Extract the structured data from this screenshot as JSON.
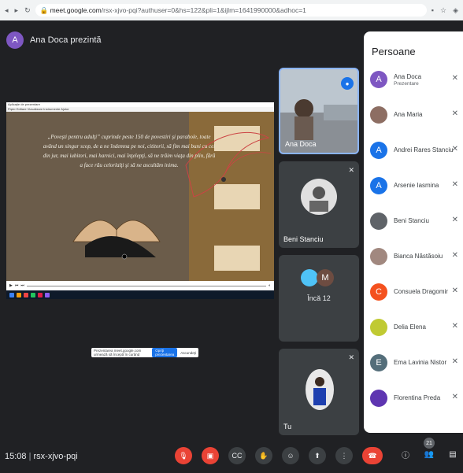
{
  "browser": {
    "url_host": "meet.google.com",
    "url_rest": "/rsx-xjvo-pqi?authuser=0&hs=122&pli=1&ijlm=1641990000&adhoc=1",
    "icons": [
      "back-icon",
      "forward-icon",
      "reload-icon",
      "lock-icon"
    ]
  },
  "presenter": {
    "initial": "A",
    "text": "Ana Doca prezintă",
    "avatar_color": "#7e57c2"
  },
  "presentation": {
    "quote": "„Poveşti pentru adulţi” cuprinde peste 150 de povestiri şi parabole, toate având un singur scop, de a ne îndemna pe noi, cititorii, să fim mai buni cu cei din jur, mai iubitori, mai harnici, mai înţelepţi, să ne trăim viaţa din plin, fără a face rău celorlalţi şi să ne ascultăm inima.",
    "share_prompt": "Prezentarea meet.google.com urmează să începă în curând",
    "share_button": "Opriţi prezentarea",
    "hide_button": "Ascundeţi"
  },
  "tiles": [
    {
      "label": "Ana Doca"
    },
    {
      "label": "Beni Stanciu"
    },
    {
      "label": "Încă 12",
      "initial": "M"
    },
    {
      "label": "Tu"
    }
  ],
  "panel": {
    "title": "Persoane",
    "people": [
      {
        "name": "Ana Doca",
        "sub": "Prezentare",
        "initial": "A",
        "color": "#7e57c2"
      },
      {
        "name": "Ana Maria",
        "sub": "",
        "initial": "",
        "color": "#8d6e63"
      },
      {
        "name": "Andrei Rares Stanciu",
        "sub": "",
        "initial": "A",
        "color": "#1a73e8"
      },
      {
        "name": "Arsenie Iasmina",
        "sub": "",
        "initial": "A",
        "color": "#1a73e8"
      },
      {
        "name": "Beni Stanciu",
        "sub": "",
        "initial": "",
        "color": "#5f6368"
      },
      {
        "name": "Bianca Năstăsoiu",
        "sub": "",
        "initial": "",
        "color": "#a1887f"
      },
      {
        "name": "Consuela Dragomir",
        "sub": "",
        "initial": "C",
        "color": "#f4511e"
      },
      {
        "name": "Delia Elena",
        "sub": "",
        "initial": "",
        "color": "#c0ca33"
      },
      {
        "name": "Ema Lavinia Nistor",
        "sub": "",
        "initial": "E",
        "color": "#546e7a"
      },
      {
        "name": "Florentina Preda",
        "sub": "",
        "initial": "",
        "color": "#5e35b1"
      }
    ]
  },
  "bottom": {
    "time": "15:08",
    "code": "rsx-xjvo-pqi",
    "people_count": "21"
  }
}
